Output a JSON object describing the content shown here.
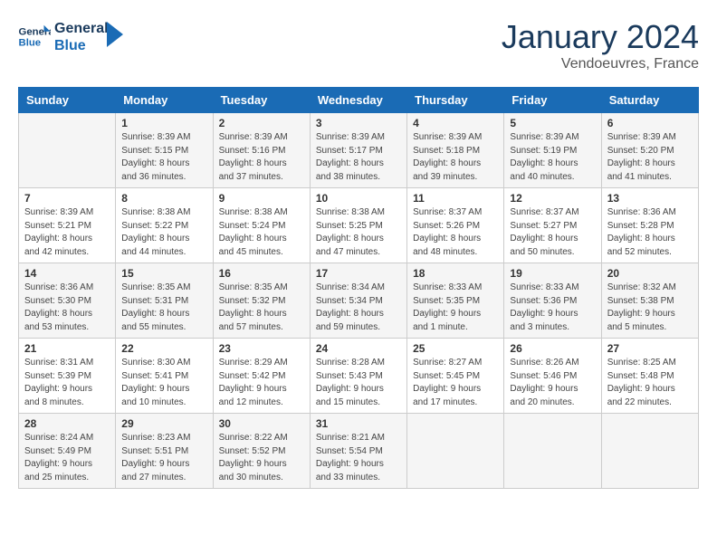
{
  "header": {
    "logo_line1": "General",
    "logo_line2": "Blue",
    "month": "January 2024",
    "location": "Vendoeuvres, France"
  },
  "days_of_week": [
    "Sunday",
    "Monday",
    "Tuesday",
    "Wednesday",
    "Thursday",
    "Friday",
    "Saturday"
  ],
  "weeks": [
    [
      {
        "day": "",
        "info": ""
      },
      {
        "day": "1",
        "info": "Sunrise: 8:39 AM\nSunset: 5:15 PM\nDaylight: 8 hours\nand 36 minutes."
      },
      {
        "day": "2",
        "info": "Sunrise: 8:39 AM\nSunset: 5:16 PM\nDaylight: 8 hours\nand 37 minutes."
      },
      {
        "day": "3",
        "info": "Sunrise: 8:39 AM\nSunset: 5:17 PM\nDaylight: 8 hours\nand 38 minutes."
      },
      {
        "day": "4",
        "info": "Sunrise: 8:39 AM\nSunset: 5:18 PM\nDaylight: 8 hours\nand 39 minutes."
      },
      {
        "day": "5",
        "info": "Sunrise: 8:39 AM\nSunset: 5:19 PM\nDaylight: 8 hours\nand 40 minutes."
      },
      {
        "day": "6",
        "info": "Sunrise: 8:39 AM\nSunset: 5:20 PM\nDaylight: 8 hours\nand 41 minutes."
      }
    ],
    [
      {
        "day": "7",
        "info": "Sunrise: 8:39 AM\nSunset: 5:21 PM\nDaylight: 8 hours\nand 42 minutes."
      },
      {
        "day": "8",
        "info": "Sunrise: 8:38 AM\nSunset: 5:22 PM\nDaylight: 8 hours\nand 44 minutes."
      },
      {
        "day": "9",
        "info": "Sunrise: 8:38 AM\nSunset: 5:24 PM\nDaylight: 8 hours\nand 45 minutes."
      },
      {
        "day": "10",
        "info": "Sunrise: 8:38 AM\nSunset: 5:25 PM\nDaylight: 8 hours\nand 47 minutes."
      },
      {
        "day": "11",
        "info": "Sunrise: 8:37 AM\nSunset: 5:26 PM\nDaylight: 8 hours\nand 48 minutes."
      },
      {
        "day": "12",
        "info": "Sunrise: 8:37 AM\nSunset: 5:27 PM\nDaylight: 8 hours\nand 50 minutes."
      },
      {
        "day": "13",
        "info": "Sunrise: 8:36 AM\nSunset: 5:28 PM\nDaylight: 8 hours\nand 52 minutes."
      }
    ],
    [
      {
        "day": "14",
        "info": "Sunrise: 8:36 AM\nSunset: 5:30 PM\nDaylight: 8 hours\nand 53 minutes."
      },
      {
        "day": "15",
        "info": "Sunrise: 8:35 AM\nSunset: 5:31 PM\nDaylight: 8 hours\nand 55 minutes."
      },
      {
        "day": "16",
        "info": "Sunrise: 8:35 AM\nSunset: 5:32 PM\nDaylight: 8 hours\nand 57 minutes."
      },
      {
        "day": "17",
        "info": "Sunrise: 8:34 AM\nSunset: 5:34 PM\nDaylight: 8 hours\nand 59 minutes."
      },
      {
        "day": "18",
        "info": "Sunrise: 8:33 AM\nSunset: 5:35 PM\nDaylight: 9 hours\nand 1 minute."
      },
      {
        "day": "19",
        "info": "Sunrise: 8:33 AM\nSunset: 5:36 PM\nDaylight: 9 hours\nand 3 minutes."
      },
      {
        "day": "20",
        "info": "Sunrise: 8:32 AM\nSunset: 5:38 PM\nDaylight: 9 hours\nand 5 minutes."
      }
    ],
    [
      {
        "day": "21",
        "info": "Sunrise: 8:31 AM\nSunset: 5:39 PM\nDaylight: 9 hours\nand 8 minutes."
      },
      {
        "day": "22",
        "info": "Sunrise: 8:30 AM\nSunset: 5:41 PM\nDaylight: 9 hours\nand 10 minutes."
      },
      {
        "day": "23",
        "info": "Sunrise: 8:29 AM\nSunset: 5:42 PM\nDaylight: 9 hours\nand 12 minutes."
      },
      {
        "day": "24",
        "info": "Sunrise: 8:28 AM\nSunset: 5:43 PM\nDaylight: 9 hours\nand 15 minutes."
      },
      {
        "day": "25",
        "info": "Sunrise: 8:27 AM\nSunset: 5:45 PM\nDaylight: 9 hours\nand 17 minutes."
      },
      {
        "day": "26",
        "info": "Sunrise: 8:26 AM\nSunset: 5:46 PM\nDaylight: 9 hours\nand 20 minutes."
      },
      {
        "day": "27",
        "info": "Sunrise: 8:25 AM\nSunset: 5:48 PM\nDaylight: 9 hours\nand 22 minutes."
      }
    ],
    [
      {
        "day": "28",
        "info": "Sunrise: 8:24 AM\nSunset: 5:49 PM\nDaylight: 9 hours\nand 25 minutes."
      },
      {
        "day": "29",
        "info": "Sunrise: 8:23 AM\nSunset: 5:51 PM\nDaylight: 9 hours\nand 27 minutes."
      },
      {
        "day": "30",
        "info": "Sunrise: 8:22 AM\nSunset: 5:52 PM\nDaylight: 9 hours\nand 30 minutes."
      },
      {
        "day": "31",
        "info": "Sunrise: 8:21 AM\nSunset: 5:54 PM\nDaylight: 9 hours\nand 33 minutes."
      },
      {
        "day": "",
        "info": ""
      },
      {
        "day": "",
        "info": ""
      },
      {
        "day": "",
        "info": ""
      }
    ]
  ]
}
